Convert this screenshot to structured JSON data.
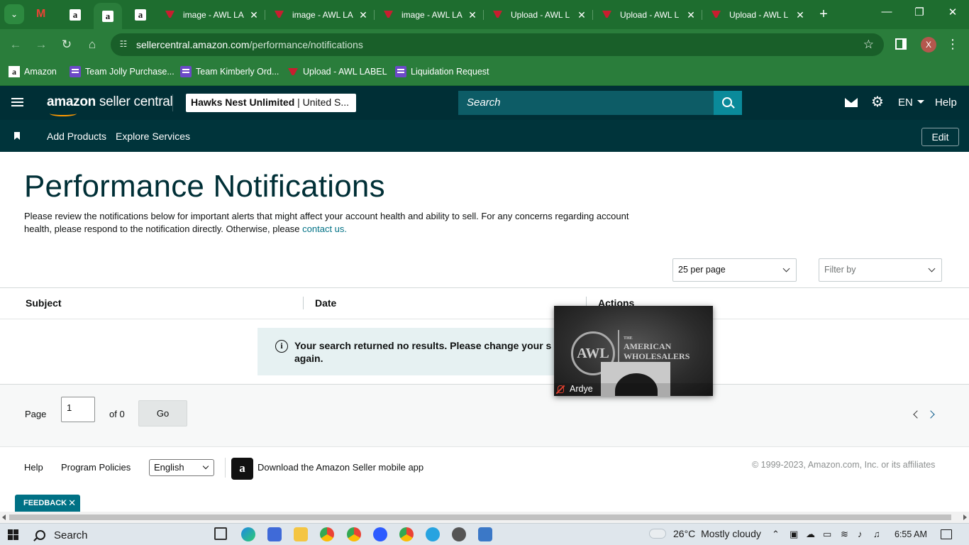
{
  "browser": {
    "tabs": [
      {
        "title": "image - AWL LA"
      },
      {
        "title": "image - AWL LA"
      },
      {
        "title": "image - AWL LA"
      },
      {
        "title": "Upload - AWL L"
      },
      {
        "title": "Upload - AWL L"
      },
      {
        "title": "Upload - AWL L"
      }
    ],
    "url_host": "sellercentral.amazon.com",
    "url_path": "/performance/notifications",
    "profile_initial": "X",
    "bookmarks": [
      "Amazon",
      "Team Jolly Purchase...",
      "Team Kimberly Ord...",
      "Upload - AWL LABEL",
      "Liquidation Request"
    ]
  },
  "header": {
    "logo_amazon": "amazon",
    "logo_rest": " seller central",
    "store_name": "Hawks Nest Unlimited",
    "store_region": " | United S...",
    "search_placeholder": "Search",
    "language": "EN",
    "help": "Help"
  },
  "subnav": {
    "items": [
      "Add Products",
      "Explore Services"
    ],
    "edit": "Edit"
  },
  "main": {
    "title": "Performance Notifications",
    "description": "Please review the notifications below for important alerts that might affect your account health and ability to sell. For any concerns regarding account health, please respond to the notification directly. Otherwise, please ",
    "contact_link": "contact us.",
    "per_page": "25 per page",
    "filter_placeholder": "Filter by",
    "columns": [
      "Subject",
      "Date",
      "Actions"
    ],
    "no_results": "Your search returned no results. Please change your s",
    "no_results_line2": "again."
  },
  "pager": {
    "page_label": "Page",
    "page_value": "1",
    "of_label": "of 0",
    "go": "Go"
  },
  "footer": {
    "help": "Help",
    "policies": "Program Policies",
    "language": "English",
    "app_text": "Download the Amazon Seller mobile app",
    "copyright": "© 1999-2023, Amazon.com, Inc. or its affiliates"
  },
  "feedback": "FEEDBACK",
  "video": {
    "participant": "Ardye",
    "brand_small": "THE",
    "brand_line1": "AMERICAN",
    "brand_line2": "WHOLESALERS",
    "brand_logo": "AWL"
  },
  "taskbar": {
    "search": "Search",
    "temperature": "26°C",
    "weather": "Mostly cloudy",
    "time": "6:55 AM"
  },
  "colors": {
    "chrome_green": "#2a7d3b",
    "sc_header": "#002f36",
    "link": "#007185",
    "alert_bg": "#e6f1f2"
  }
}
